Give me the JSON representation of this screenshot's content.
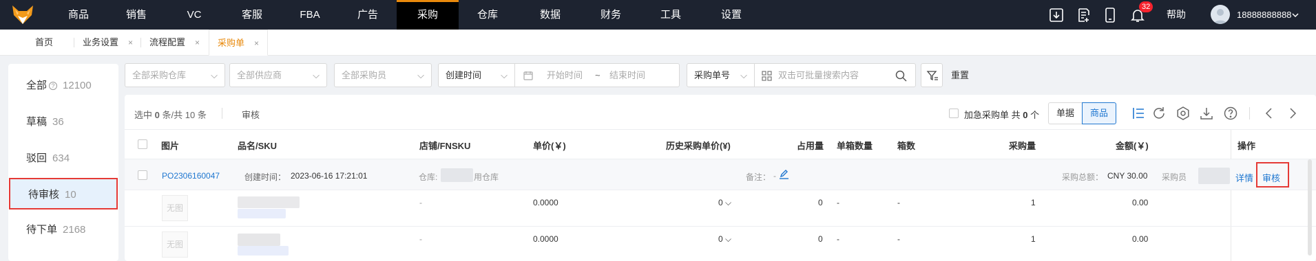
{
  "topnav": {
    "items": [
      "商品",
      "销售",
      "VC",
      "客服",
      "FBA",
      "广告",
      "采购",
      "仓库",
      "数据",
      "财务",
      "工具",
      "设置"
    ],
    "active": "采购",
    "notification_count": "32",
    "help": "帮助",
    "username": "18888888888",
    "icons": [
      "download-icon",
      "task-list-icon",
      "mobile-icon",
      "bell-icon"
    ]
  },
  "tabs": {
    "home": "首页",
    "items": [
      {
        "label": "业务设置",
        "close": "×"
      },
      {
        "label": "流程配置",
        "close": "×"
      },
      {
        "label": "采购单",
        "close": "×"
      }
    ]
  },
  "sidebar": {
    "items": [
      {
        "label": "全部",
        "count": "12100",
        "help": "?"
      },
      {
        "label": "草稿",
        "count": "36"
      },
      {
        "label": "驳回",
        "count": "634"
      },
      {
        "label": "待审核",
        "count": "10"
      },
      {
        "label": "待下单",
        "count": "2168"
      }
    ],
    "selected": "待审核"
  },
  "filters": {
    "warehouse": "全部采购仓库",
    "supplier": "全部供应商",
    "buyer": "全部采购员",
    "time_type": "创建时间",
    "start_placeholder": "开始时间",
    "range_sep": "~",
    "end_placeholder": "结束时间",
    "search_type": "采购单号",
    "search_placeholder": "双击可批量搜索内容",
    "reset": "重置"
  },
  "toolbar": {
    "selection_prefix": "选中",
    "selected_count": "0",
    "selection_mid": "条/共",
    "total_count": "10",
    "selection_suffix": "条",
    "audit": "审核",
    "urgent_prefix": "加急采购单 共",
    "urgent_count": "0",
    "urgent_suffix": "个",
    "view_doc": "单据",
    "view_product": "商品"
  },
  "table": {
    "headers": [
      "图片",
      "品名/SKU",
      "店铺/FNSKU",
      "单价(￥)",
      "历史采购单价(¥)",
      "占用量",
      "单箱数量",
      "箱数",
      "采购量",
      "金额(￥)",
      "操作"
    ],
    "order": {
      "id": "PO2306160047",
      "created_label": "创建时间：",
      "created": "2023-06-16 17:21:01",
      "warehouse_label": "仓库:",
      "warehouse_suffix": "用仓库",
      "remark_label": "备注：",
      "remark_value": "-",
      "total_label": "采购总额：",
      "total": "CNY 30.00",
      "buyer_label": "采购员",
      "detail": "详情",
      "audit": "审核"
    },
    "rows": [
      {
        "image": "无图",
        "shop": "-",
        "price": "0.0000",
        "history": "0",
        "occupied": "0",
        "per_box": "-",
        "boxes": "-",
        "qty": "1",
        "amount": "0.00"
      },
      {
        "image": "无图",
        "shop": "-",
        "price": "0.0000",
        "history": "0",
        "occupied": "0",
        "per_box": "-",
        "boxes": "-",
        "qty": "1",
        "amount": "0.00"
      }
    ]
  },
  "colors": {
    "nav_bg": "#1d2330",
    "accent": "#e8890c",
    "link": "#1f77d0",
    "highlight": "#e53935",
    "selected_bg": "#e6f1fc"
  }
}
